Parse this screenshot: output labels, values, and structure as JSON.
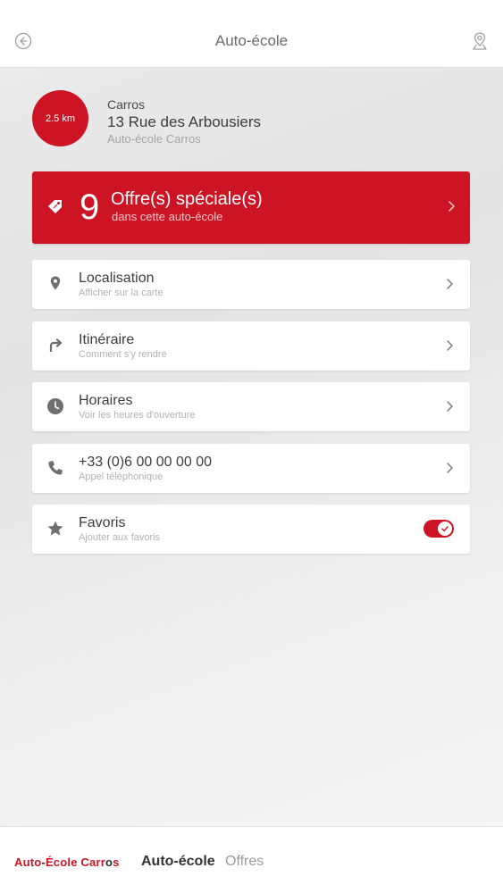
{
  "header": {
    "title": "Auto-école"
  },
  "summary": {
    "distance": "2.5 km",
    "city": "Carros",
    "address": "13 Rue des Arbousiers",
    "school_name": "Auto-école Carros"
  },
  "offers": {
    "count": "9",
    "title": "Offre(s) spéciale(s)",
    "subtitle": "dans cette auto-école"
  },
  "actions": [
    {
      "title": "Localisation",
      "subtitle": "Afficher sur la carte",
      "icon": "location-pin-icon"
    },
    {
      "title": "Itinéraire",
      "subtitle": "Comment s'y rendre",
      "icon": "turn-right-arrow-icon"
    },
    {
      "title": "Horaires",
      "subtitle": "Voir les heures d'ouverture",
      "icon": "clock-icon"
    },
    {
      "title": "+33 (0)6 00 00 00 00",
      "subtitle": "Appel téléphonique",
      "icon": "phone-icon"
    }
  ],
  "favorite": {
    "title": "Favoris",
    "subtitle": "Ajouter aux favoris",
    "enabled": true
  },
  "bottom_nav": {
    "brand_part1": "Auto",
    "brand_dash1": "-",
    "brand_part2": "École",
    "brand_part3": " Carr",
    "brand_part4": "o",
    "brand_part5": "s",
    "tab_active": "Auto-école",
    "tab_offers": "Offres"
  },
  "colors": {
    "accent": "#cc1424",
    "background": "#e8e8e8",
    "card": "#ffffff",
    "text": "#3d3d3d",
    "muted": "#b2b2b2"
  }
}
